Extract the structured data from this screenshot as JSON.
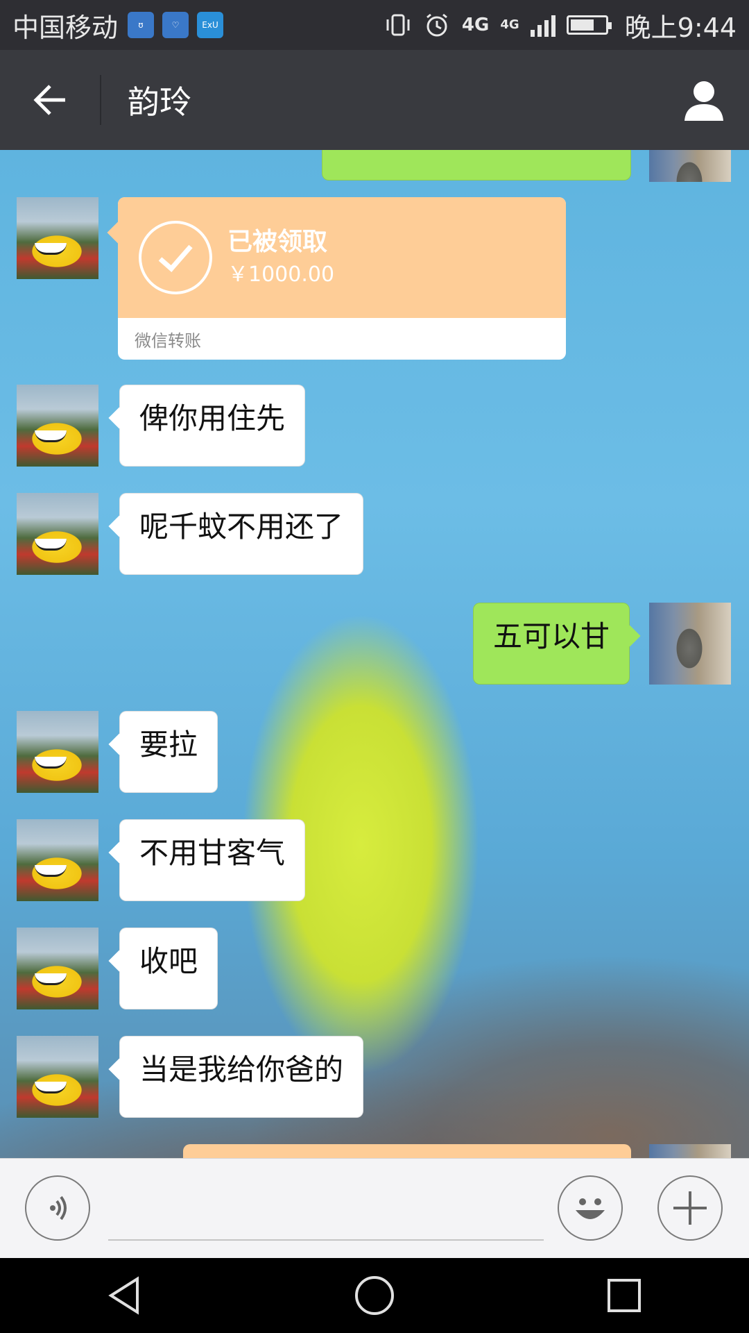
{
  "status_bar": {
    "carrier": "中国移动",
    "apps": [
      {
        "icon": "app-notification-icon",
        "color": "#3a78c8",
        "text": "ʊ"
      },
      {
        "icon": "app-health-icon",
        "color": "#3a78c8",
        "text": "♡"
      },
      {
        "icon": "app-exu-icon",
        "color": "#2a8fd8",
        "text": "ExU"
      }
    ],
    "network_1": "4G",
    "network_2": "4G",
    "time": "晚上9:44",
    "battery_level": 0.7
  },
  "header": {
    "title": "韵玲",
    "back_icon": "back-arrow-icon",
    "profile_icon": "person-icon"
  },
  "chat": {
    "transfer": {
      "status": "已被领取",
      "amount": "￥1000.00",
      "source": "微信转账",
      "colors": {
        "card": "#fecd97"
      }
    },
    "messages": [
      {
        "side": "in",
        "text": "俾你用住先"
      },
      {
        "side": "in",
        "text": "呢千蚊不用还了"
      },
      {
        "side": "out",
        "text": "五可以甘"
      },
      {
        "side": "in",
        "text": "要拉"
      },
      {
        "side": "in",
        "text": "不用甘客气"
      },
      {
        "side": "in",
        "text": "收吧"
      },
      {
        "side": "in",
        "text": "当是我给你爸的"
      }
    ],
    "colors": {
      "incoming": "#ffffff",
      "outgoing": "#9fe65a"
    }
  },
  "input_bar": {
    "placeholder": "",
    "voice_icon": "voice-icon",
    "emoji_icon": "emoji-icon",
    "more_icon": "plus-icon"
  },
  "nav_bar": {
    "back": "nav-back-icon",
    "home": "nav-home-icon",
    "recent": "nav-recent-icon"
  }
}
